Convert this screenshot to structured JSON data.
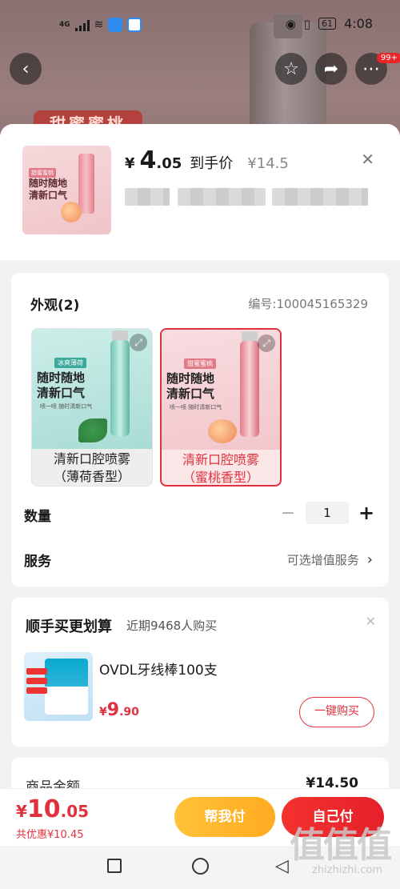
{
  "status_bar": {
    "time": "4:08",
    "battery": "61",
    "network": "4G"
  },
  "background": {
    "tag": "甜蜜蜜桃",
    "notif_badge": "99+"
  },
  "header": {
    "price_yen": "¥",
    "price_int": "4",
    "price_dec": ".05",
    "price_label": "到手价",
    "original_price": "¥14.5",
    "thumb_tag": "甜蜜蜜桃",
    "thumb_text": "随时随地清新口气"
  },
  "options": {
    "title": "外观(2)",
    "code": "编号:100045165329",
    "variants": [
      {
        "tag": "冰爽薄荷",
        "headline": "随时随地清新口气",
        "sub": "喷一喷 随时清新口气",
        "label_line1": "清新口腔喷雾",
        "label_line2": "（薄荷香型）",
        "selected": false
      },
      {
        "tag": "甜蜜蜜桃",
        "headline": "随时随地清新口气",
        "sub": "喷一喷 随时清新口气",
        "label_line1": "清新口腔喷雾",
        "label_line2": "（蜜桃香型）",
        "selected": true
      }
    ],
    "quantity_label": "数量",
    "quantity": "1",
    "minus": "−",
    "plus": "+",
    "service_label": "服务",
    "service_value": "可选增值服务"
  },
  "addon": {
    "title": "顺手买更划算",
    "subtitle": "近期9468人购买",
    "product_name": "OVDL牙线棒100支",
    "price_yen": "¥",
    "price_int": "9",
    "price_dec": ".90",
    "buy_label": "一键购买"
  },
  "amount": {
    "label": "商品金额",
    "value": "¥14.50"
  },
  "bottom": {
    "total_yen": "¥",
    "total_int": "10",
    "total_dec": ".05",
    "saved": "共优惠¥10.45",
    "help_pay": "帮我付",
    "self_pay": "自己付"
  },
  "watermark": {
    "main": "值值值",
    "sub": "zhizhizhi.com"
  }
}
